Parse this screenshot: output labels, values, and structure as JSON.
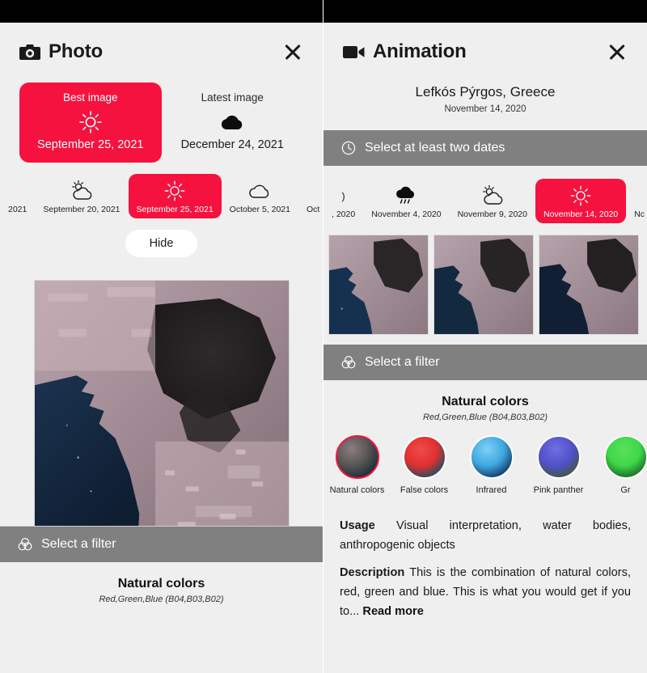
{
  "accent_color": "#F5123E",
  "bar_color": "#808080",
  "panel_bg": "#efefef",
  "photo_panel": {
    "title": "Photo",
    "title_icon": "camera-icon",
    "close_icon": "close-icon",
    "best_card": {
      "label": "Best image",
      "icon": "sun-icon",
      "date": "September 25, 2021"
    },
    "latest_card": {
      "label": "Latest image",
      "icon": "cloud-filled-icon",
      "date": "December 24, 2021"
    },
    "timeline": [
      {
        "date": "2021",
        "icon": "none",
        "selected": false,
        "edge": true
      },
      {
        "date": "September 20, 2021",
        "icon": "sun-behind-cloud-icon",
        "selected": false,
        "edge": false
      },
      {
        "date": "September 25, 2021",
        "icon": "sun-icon",
        "selected": true,
        "edge": false
      },
      {
        "date": "October 5, 2021",
        "icon": "cloud-outline-icon",
        "selected": false,
        "edge": false
      },
      {
        "date": "Oct",
        "icon": "none",
        "selected": false,
        "edge": true
      }
    ],
    "hide_button": "Hide",
    "filter_bar": {
      "icon": "venn-filter-icon",
      "label": "Select a filter"
    },
    "filter_title": "Natural colors",
    "filter_subtitle": "Red,Green,Blue (B04,B03,B02)"
  },
  "animation_panel": {
    "title": "Animation",
    "title_icon": "video-camera-icon",
    "close_icon": "close-icon",
    "location": "Lefkós Pýrgos, Greece",
    "location_date": "November 14, 2020",
    "notice_bar": {
      "icon": "clock-icon",
      "label": "Select at least two dates"
    },
    "timeline": [
      {
        "date": ", 2020",
        "icon": "paren-clip",
        "selected": false,
        "edge": true
      },
      {
        "date": "November 4, 2020",
        "icon": "rain-cloud-icon",
        "selected": false,
        "edge": false
      },
      {
        "date": "November 9, 2020",
        "icon": "sun-behind-cloud-icon",
        "selected": false,
        "edge": false
      },
      {
        "date": "November 14, 2020",
        "icon": "sun-icon",
        "selected": true,
        "edge": false
      },
      {
        "date": "Nc",
        "icon": "none",
        "selected": false,
        "edge": true
      }
    ],
    "filter_bar": {
      "icon": "venn-filter-icon",
      "label": "Select a filter"
    },
    "filter_title": "Natural colors",
    "filter_subtitle": "Red,Green,Blue (B04,B03,B02)",
    "filters": [
      {
        "name": "Natural colors",
        "selected": true
      },
      {
        "name": "False colors",
        "selected": false
      },
      {
        "name": "Infrared",
        "selected": false
      },
      {
        "name": "Pink panther",
        "selected": false
      },
      {
        "name": "Gr",
        "selected": false
      }
    ],
    "usage_label": "Usage",
    "usage_text": "Visual interpretation, water bodies, anthropogenic objects",
    "description_label": "Description",
    "description_text": "This is the combination of natural colors, red, green and blue. This is what you would get if you to...",
    "read_more": "Read more"
  }
}
